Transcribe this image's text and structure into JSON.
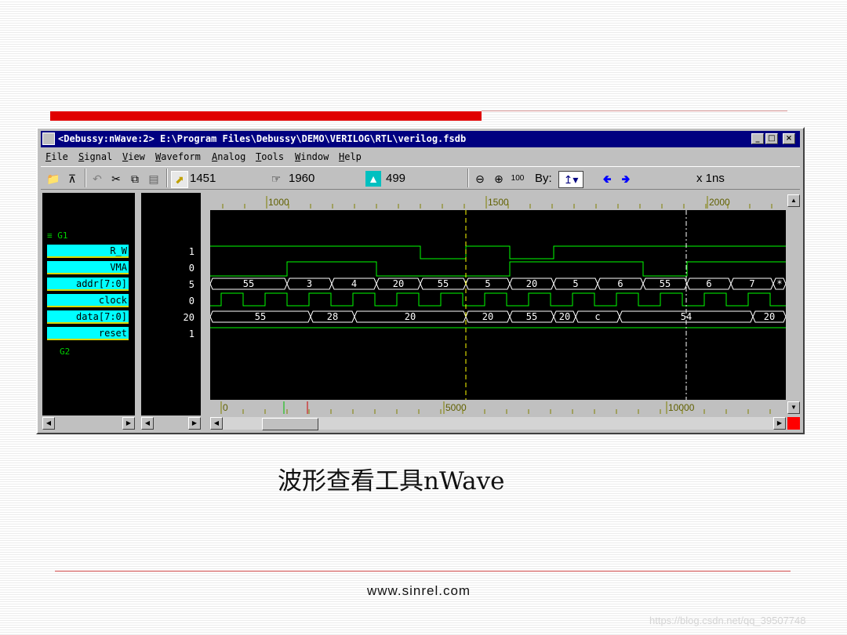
{
  "window": {
    "title": "<Debussy:nWave:2> E:\\Program Files\\Debussy\\DEMO\\VERILOG\\RTL\\verilog.fsdb",
    "minimize": "_",
    "maximize": "□",
    "close": "×"
  },
  "menu": [
    "File",
    "Signal",
    "View",
    "Waveform",
    "Analog",
    "Tools",
    "Window",
    "Help"
  ],
  "toolbar": {
    "cursor_time": "1451",
    "marker_time": "1960",
    "delta_time": "499",
    "zoom_fit_label": "100",
    "by_label": "By:",
    "unit_label": "x 1ns"
  },
  "groups": [
    "G1",
    "G2"
  ],
  "signals": [
    {
      "name": "R_W",
      "value": "1"
    },
    {
      "name": "VMA",
      "value": "0"
    },
    {
      "name": "addr[7:0]",
      "value": "5"
    },
    {
      "name": "clock",
      "value": "0"
    },
    {
      "name": "data[7:0]",
      "value": "20"
    },
    {
      "name": "reset",
      "value": "1"
    }
  ],
  "time_ruler": {
    "labels": [
      "1000",
      "1500",
      "2000"
    ]
  },
  "overview_ruler": {
    "labels": [
      "0",
      "5000",
      "10000"
    ]
  },
  "bus_values": {
    "addr": [
      "55",
      "3",
      "4",
      "20",
      "55",
      "5",
      "20",
      "5",
      "6",
      "55",
      "6",
      "7",
      "*"
    ],
    "data": [
      "55",
      "28",
      "20",
      "20",
      "55",
      "20",
      "c",
      "54",
      "20"
    ]
  },
  "colors": {
    "wave": "#00ff00",
    "cursor": "#ffff00",
    "marker": "#ffffff",
    "signal_bg": "#00ffff",
    "titlebar": "#000080",
    "accent_red": "#e00000"
  },
  "caption": "波形查看工具nWave",
  "footer": "www.sinrel.com",
  "watermark": "https://blog.csdn.net/qq_39507748"
}
